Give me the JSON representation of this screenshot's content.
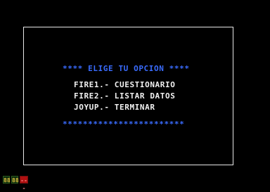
{
  "menu": {
    "title": "**** ELIGE TU OPCION ****",
    "options": [
      {
        "label": "FIRE1.- CUESTIONARIO"
      },
      {
        "label": "FIRE2.- LISTAR DATOS"
      },
      {
        "label": "JOYUP.- TERMINAR"
      }
    ],
    "footer": "************************"
  },
  "status_bar": {
    "indicators": [
      {
        "text": "88",
        "color": "#e0c040"
      },
      {
        "text": "88",
        "color": "#e0c040"
      },
      {
        "text": "---",
        "color": "#ff8a8a"
      }
    ]
  },
  "colors": {
    "background": "#000000",
    "frame": "#e8e8e8",
    "accent": "#3a6cff",
    "text": "#f2f2f2",
    "indicator_red": "#b01010"
  }
}
